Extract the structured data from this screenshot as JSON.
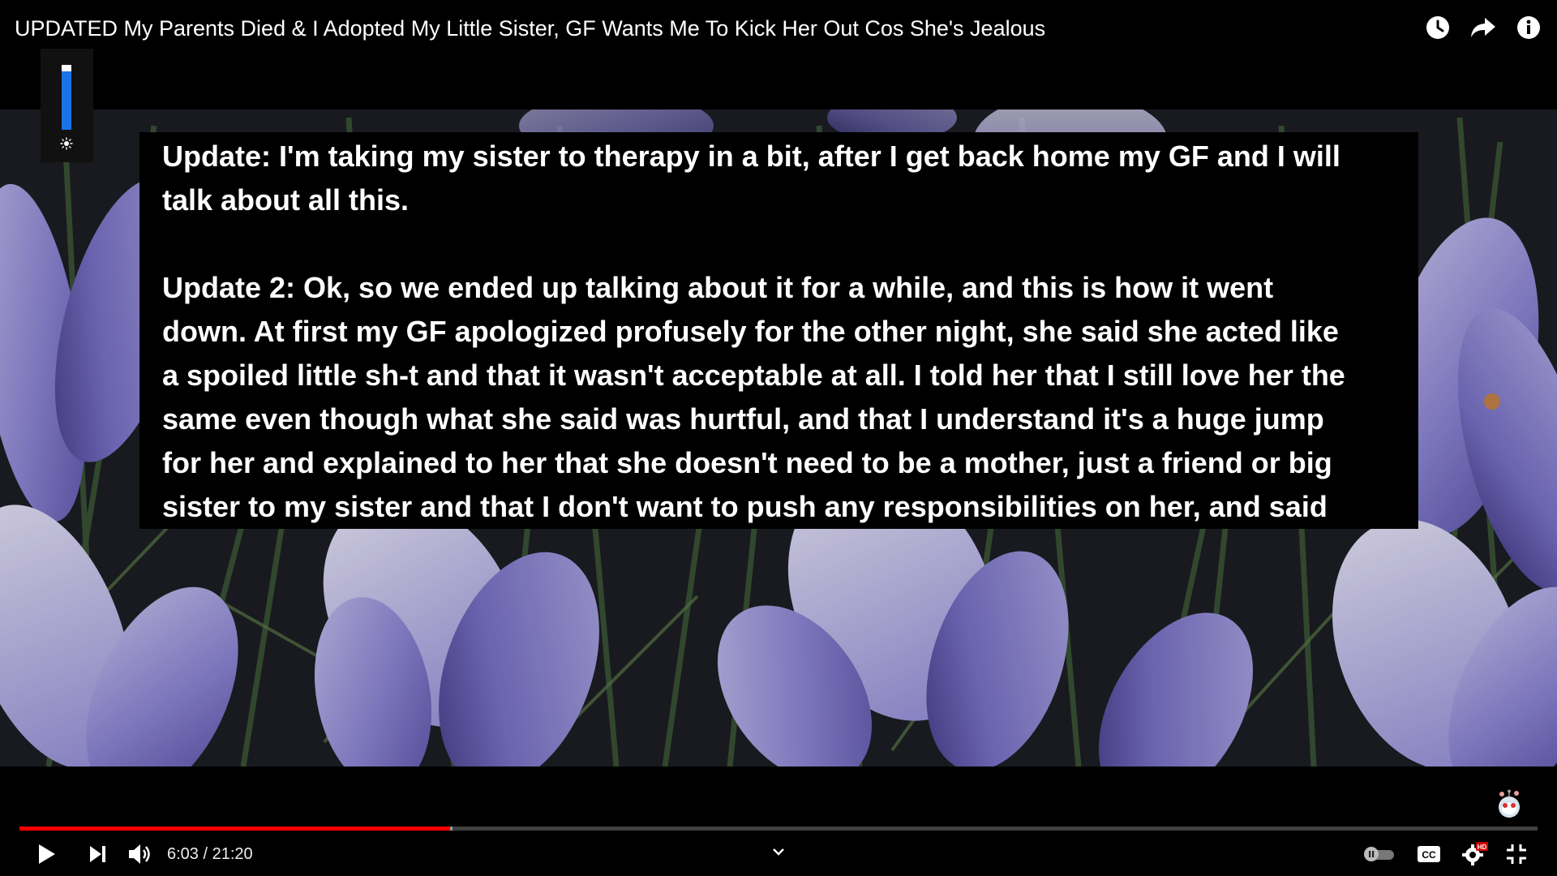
{
  "title": "UPDATED My Parents Died & I Adopted My Little Sister, GF Wants Me To Kick Her Out Cos She's Jealous",
  "top_icons": [
    "clock-icon",
    "share-icon",
    "info-icon"
  ],
  "brightness": {
    "level": 0.9,
    "icon": "sun-icon"
  },
  "caption": {
    "paragraph1": "Update: I'm taking my sister to therapy in a bit, after I get back home my GF and I will\ntalk about all this.",
    "paragraph2": "Update 2: Ok, so we ended up talking about it for a while, and this is how it went\ndown. At first my GF apologized profusely for the other night, she said she acted like\na spoiled little sh-t and that it wasn't acceptable at all. I told her that I still love her the\nsame even though what she said was hurtful, and that I understand it's a huge jump\nfor her and explained to her that she doesn't need to be a mother, just a friend or big\nsister to my sister and that I don't want to push any responsibilities on her, and said"
  },
  "player": {
    "current_time": "6:03",
    "duration": "21:20",
    "time_display": "6:03 / 21:20",
    "played_fraction": 0.2836,
    "buffered_fraction": 0.2855,
    "hd_badge": "HD",
    "cc_label": "CC"
  },
  "colors": {
    "progress_played": "#ff0000",
    "brightness_fill": "#1a73e8",
    "hd_badge": "#cc0000",
    "petal": "#8f8ad6"
  }
}
